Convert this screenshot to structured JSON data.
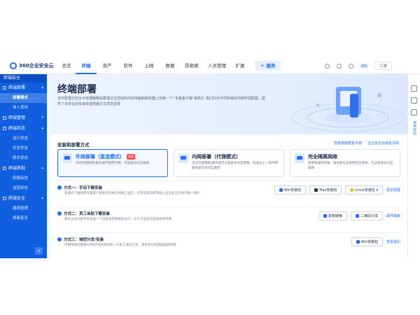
{
  "brand": {
    "name": "360企业安全云"
  },
  "nav": {
    "items": [
      "总览",
      "终端",
      "资产",
      "软件",
      "上网",
      "数据",
      "防勒索",
      "人员管理",
      "扩展"
    ],
    "active_index": 1,
    "service": "服务"
  },
  "topright": {
    "msg": "通知",
    "enterprise": "工单"
  },
  "sidebar": {
    "header": "终端安全",
    "groups": [
      {
        "label": "终端部署",
        "items": [
          "部署模式",
          "准入规则"
        ]
      },
      {
        "label": "终端管理",
        "items": []
      },
      {
        "label": "终端状态",
        "items": [
          "运行状态",
          "安全状态",
          "版本状态"
        ]
      },
      {
        "label": "终端审批",
        "items": [
          "卸载审批",
          "加固审批"
        ]
      },
      {
        "label": "终端安全",
        "items": [
          "漏洞管理",
          "病毒查杀"
        ]
      }
    ],
    "active_item": "部署模式"
  },
  "hero": {
    "title": "终端部署",
    "description": "您可配置的安全与管理策略需要通过在您组织内的电脑和服务器上安装一个“专属客户端”来执行 我们针对不同的组织内网环境配置，提供了多样化的快速安装部署方式供您选择"
  },
  "deploy": {
    "section_title": "安装和部署方式",
    "links": [
      "查看网络配置手册",
      "企业安全云域名清单"
    ],
    "cards": [
      {
        "title": "外网部署（直连模式）",
        "badge": "推荐",
        "desc": "适合内部网络/服务器不使用内网，可直接访问互联网",
        "selected": true
      },
      {
        "title": "内网部署（代理模式）",
        "badge": "",
        "desc": "适合内部网络/服务器无法直接访问互联网，但通过上一级内网服务器可访问互联网",
        "selected": false
      },
      {
        "title": "完全隔离网络",
        "badge": "",
        "desc": "需要管理的终端、服务器与互联网完全隔离，无法直接访问互联网",
        "selected": false
      }
    ]
  },
  "methods": [
    {
      "name": "方式一：手动下载安装",
      "desc": "管理员下载组织专属客户端安装包并在终端上运行，已完成安装即刻接入企业安全云进行统一管控",
      "buttons": [
        {
          "label": "Win安装包",
          "icon": "windows-icon",
          "style": ""
        },
        {
          "label": "Mac安装包",
          "icon": "apple-icon",
          "style": "dark"
        },
        {
          "label": "Linux安装包 ▾",
          "icon": "linux-icon",
          "style": "linux"
        }
      ],
      "link": "更多配置"
    },
    {
      "name": "方式二：员工自助下载安装",
      "desc": "通过企业内部平台发送一个自助安装链接给员工，员工点击后可自助安装终端",
      "buttons": [
        {
          "label": "复制链接",
          "icon": "link-icon",
          "style": ""
        },
        {
          "label": "二维码分享",
          "icon": "qrcode-icon",
          "style": ""
        }
      ],
      "link": "邮件模板"
    },
    {
      "name": "方式三：域控分发/安装",
      "desc": "可使用通过配置AD域环境或其他统一分发工具的方式，将安装包批量推送到终端",
      "buttons": [
        {
          "label": "Win安装包",
          "icon": "windows-icon",
          "style": ""
        }
      ],
      "link": "查看指引"
    }
  ],
  "rail": {
    "vertical_label": "使用帮助"
  }
}
